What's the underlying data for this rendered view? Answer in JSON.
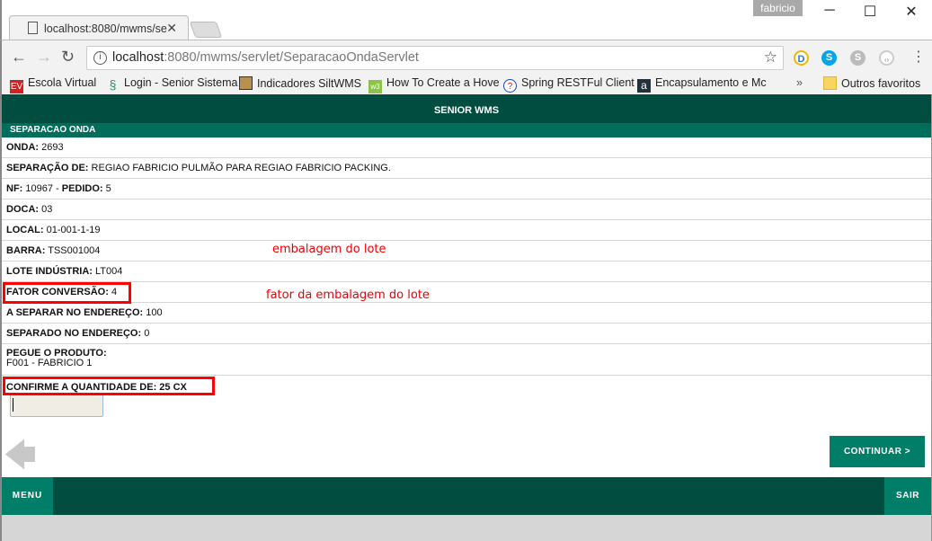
{
  "browser": {
    "tab_title": "localhost:8080/mwms/se",
    "user": "fabricio",
    "url_host": "localhost",
    "url_rest": ":8080/mwms/servlet/SeparacaoOndaServlet",
    "bookmarks": [
      "Escola Virtual",
      "Login - Senior Sistema",
      "Indicadores SiltWMS",
      "How To Create a Hove",
      "Spring RESTFul Client",
      "Encapsulamento e Mc"
    ],
    "other_bookmarks": "Outros favoritos"
  },
  "app": {
    "title": "SENIOR WMS",
    "section": "SEPARACAO ONDA",
    "rows": [
      {
        "label": "ONDA:",
        "value": " 2693"
      },
      {
        "label": "SEPARAÇÃO DE:",
        "value": " REGIAO FABRICIO PULMÃO PARA REGIAO FABRICIO PACKING."
      },
      {
        "label": "NF:",
        "value": " 10967 - ",
        "label2": "PEDIDO:",
        "value2": " 5"
      },
      {
        "label": "DOCA:",
        "value": " 03"
      },
      {
        "label": "LOCAL:",
        "value": " 01-001-1-19"
      },
      {
        "label": "BARRA:",
        "value": " TSS001004"
      },
      {
        "label": "LOTE INDÚSTRIA:",
        "value": " LT004"
      },
      {
        "label": "FATOR CONVERSÃO:",
        "value": " 4"
      },
      {
        "label": "A SEPARAR NO ENDEREÇO:",
        "value": " 100"
      },
      {
        "label": "SEPARADO NO ENDEREÇO:",
        "value": " 0"
      }
    ],
    "product_label": "PEGUE O PRODUTO:",
    "product_value": "F001 - FABRICIO 1",
    "confirm_label": "CONFIRME A QUANTIDADE DE: 25 CX",
    "quantity_value": "",
    "continue_label": "CONTINUAR >",
    "menu_label": "MENU",
    "exit_label": "SAIR"
  },
  "annotations": {
    "note1": "embalagem do lote",
    "note2": "fator da embalagem do lote"
  }
}
